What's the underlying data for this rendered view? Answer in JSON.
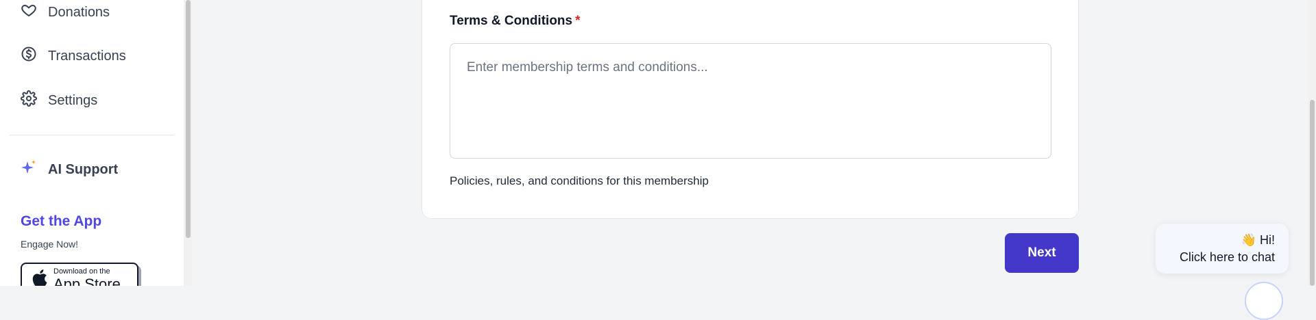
{
  "sidebar": {
    "items": [
      {
        "label": "Donations",
        "icon": "heart-icon"
      },
      {
        "label": "Transactions",
        "icon": "dollar-circle-icon"
      },
      {
        "label": "Settings",
        "icon": "gear-icon"
      }
    ],
    "ai_support": {
      "label": "AI Support",
      "icon": "sparkle-icon"
    },
    "get_app": {
      "title": "Get the App",
      "subtitle": "Engage Now!",
      "appstore_small": "Download on the",
      "appstore_big": "App Store"
    }
  },
  "form": {
    "terms_label": "Terms & Conditions",
    "required_mark": "*",
    "terms_placeholder": "Enter membership terms and conditions...",
    "terms_value": "",
    "terms_helper": "Policies, rules, and conditions for this membership"
  },
  "actions": {
    "next_label": "Next"
  },
  "chat": {
    "greeting": "👋 Hi!",
    "prompt": "Click here to chat"
  },
  "colors": {
    "accent": "#4338ca",
    "brand_text": "#4f46e5",
    "required": "#dc2626"
  }
}
